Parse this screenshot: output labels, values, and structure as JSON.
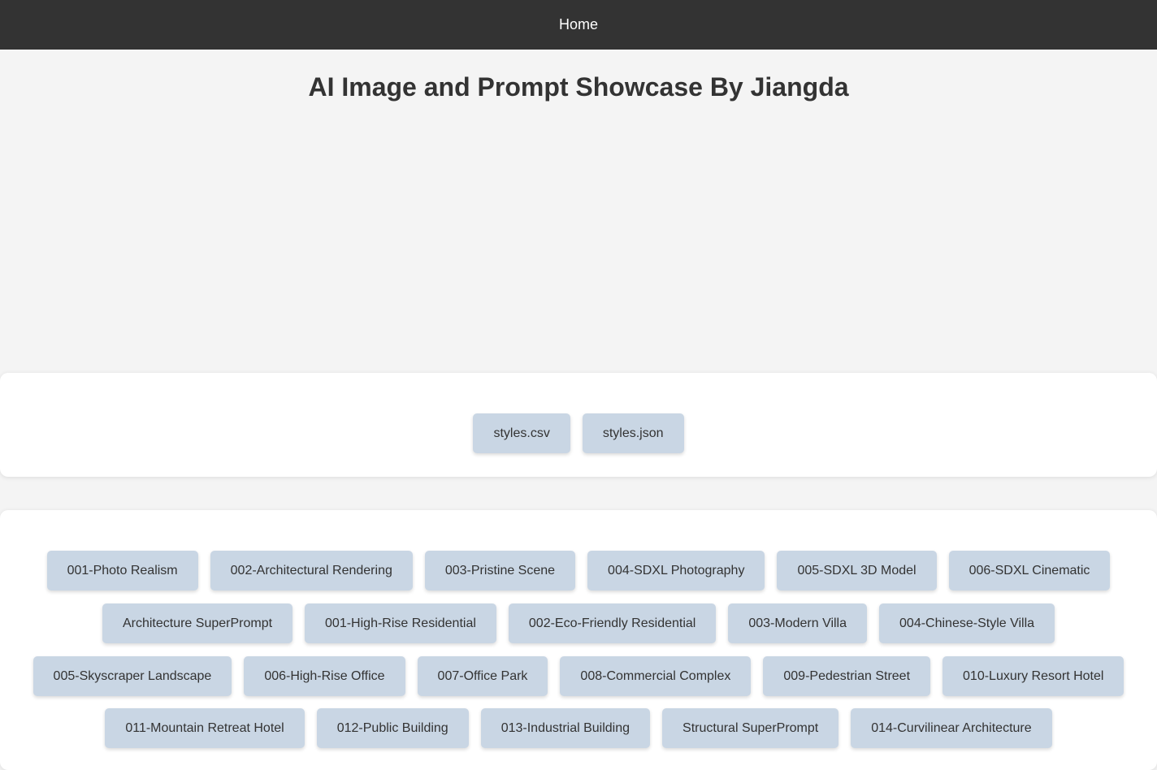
{
  "nav": {
    "home_label": "Home"
  },
  "page": {
    "title": "AI Image and Prompt Showcase By Jiangda"
  },
  "downloads": [
    {
      "label": "styles.csv"
    },
    {
      "label": "styles.json"
    }
  ],
  "styles": {
    "row1": [
      {
        "label": "001-Photo Realism"
      },
      {
        "label": "002-Architectural Rendering"
      },
      {
        "label": "003-Pristine Scene"
      },
      {
        "label": "004-SDXL Photography"
      },
      {
        "label": "005-SDXL 3D Model"
      },
      {
        "label": "006-SDXL Cinematic"
      }
    ],
    "row2": [
      {
        "label": "Architecture SuperPrompt"
      },
      {
        "label": "001-High-Rise Residential"
      },
      {
        "label": "002-Eco-Friendly Residential"
      },
      {
        "label": "003-Modern Villa"
      },
      {
        "label": "004-Chinese-Style Villa"
      }
    ],
    "row3": [
      {
        "label": "005-Skyscraper Landscape"
      },
      {
        "label": "006-High-Rise Office"
      },
      {
        "label": "007-Office Park"
      },
      {
        "label": "008-Commercial Complex"
      },
      {
        "label": "009-Pedestrian Street"
      },
      {
        "label": "010-Luxury Resort Hotel"
      }
    ],
    "row4": [
      {
        "label": "011-Mountain Retreat Hotel"
      },
      {
        "label": "012-Public Building"
      },
      {
        "label": "013-Industrial Building"
      },
      {
        "label": "Structural SuperPrompt"
      },
      {
        "label": "014-Curvilinear Architecture"
      }
    ]
  },
  "colors": {
    "navbar_bg": "#333333",
    "page_bg": "#f4f4f4",
    "button_bg": "#c9d6e4",
    "text": "#333333"
  }
}
